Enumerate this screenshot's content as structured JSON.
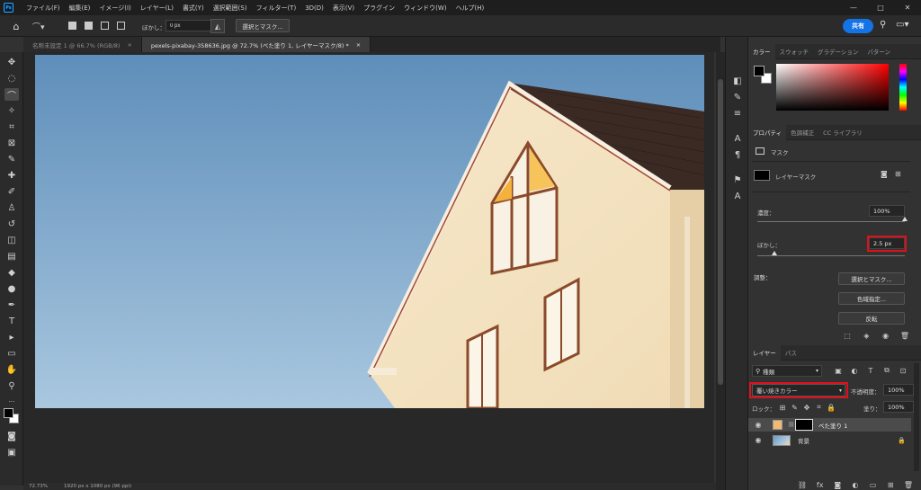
{
  "app": {
    "logo": "Ps"
  },
  "menu": [
    "ファイル(F)",
    "編集(E)",
    "イメージ(I)",
    "レイヤー(L)",
    "書式(Y)",
    "選択範囲(S)",
    "フィルター(T)",
    "3D(D)",
    "表示(V)",
    "プラグイン",
    "ウィンドウ(W)",
    "ヘルプ(H)"
  ],
  "window_controls": {
    "minimize": "—",
    "maximize": "□",
    "close": "✕"
  },
  "options": {
    "feather_label": "ぼかし：",
    "feather_value": "0 px",
    "select_mask_label": "選択とマスク...",
    "share_label": "共有"
  },
  "tabs": [
    {
      "label": "名称未設定 1 @ 66.7% (RGB/8)",
      "close": "×"
    },
    {
      "label": "pexels-pixabay-358636.jpg @ 72.7% (べた塗り 1, レイヤーマスク/8) *",
      "close": "×"
    }
  ],
  "status": {
    "zoom": "72.73%",
    "doc_size": "1920 px x 1080 px (96 ppi)"
  },
  "color_panel": {
    "tabs": [
      "カラー",
      "スウォッチ",
      "グラデーション",
      "パターン"
    ]
  },
  "properties_panel": {
    "tabs": [
      "プロパティ",
      "色調補正",
      "CC ライブラリ"
    ],
    "mask_header": "マスク",
    "layer_mask_label": "レイヤーマスク",
    "density_label": "濃度：",
    "density_value": "100%",
    "density_level": 1.0,
    "feather_label": "ぼかし：",
    "feather_value": "2.5 px",
    "feather_level": 0.03,
    "adjust_label": "調整：",
    "select_mask_button": "選択とマスク...",
    "color_range_button": "色域指定...",
    "invert_button": "反転"
  },
  "layers_panel": {
    "tabs": [
      "レイヤー",
      "パス"
    ],
    "filter_label": "種類",
    "blend_mode": "覆い焼きカラー",
    "opacity_label": "不透明度：",
    "opacity_value": "100%",
    "lock_label": "ロック：",
    "fill_label": "塗り：",
    "fill_value": "100%",
    "layers": [
      {
        "name": "べた塗り 1",
        "selected": true,
        "swatch": "#f4b870"
      },
      {
        "name": "背景",
        "selected": false,
        "locked": true
      }
    ],
    "footer_icons": [
      "link-icon",
      "fx-icon",
      "mask-icon",
      "adjustment-icon",
      "folder-icon",
      "new-layer-icon",
      "trash-icon"
    ]
  },
  "colors": {
    "accent": "#1473e6",
    "highlight": "#e0101b",
    "fg": "#000000",
    "bg": "#ffffff"
  }
}
